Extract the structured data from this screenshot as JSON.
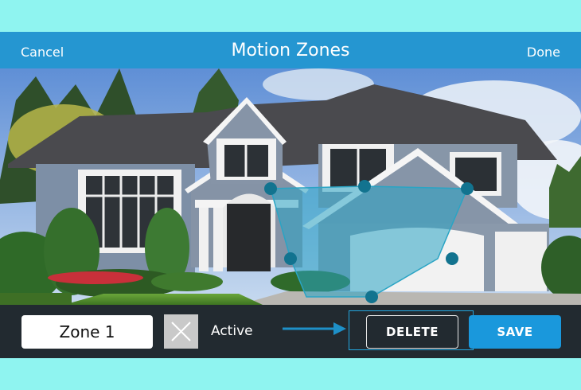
{
  "navbar": {
    "cancel_label": "Cancel",
    "title": "Motion Zones",
    "done_label": "Done"
  },
  "toolbar": {
    "zone_name": "Zone 1",
    "active_label": "Active",
    "delete_label": "DELETE",
    "save_label": "SAVE"
  },
  "colors": {
    "background": "#8ff4f0",
    "navbar": "#2596d1",
    "toolbar": "#222a30",
    "accent": "#1a98dc",
    "zone_fill": "#2aa4c4"
  },
  "icons": {
    "toggle": "x-icon",
    "pointer": "arrow-right-icon"
  }
}
